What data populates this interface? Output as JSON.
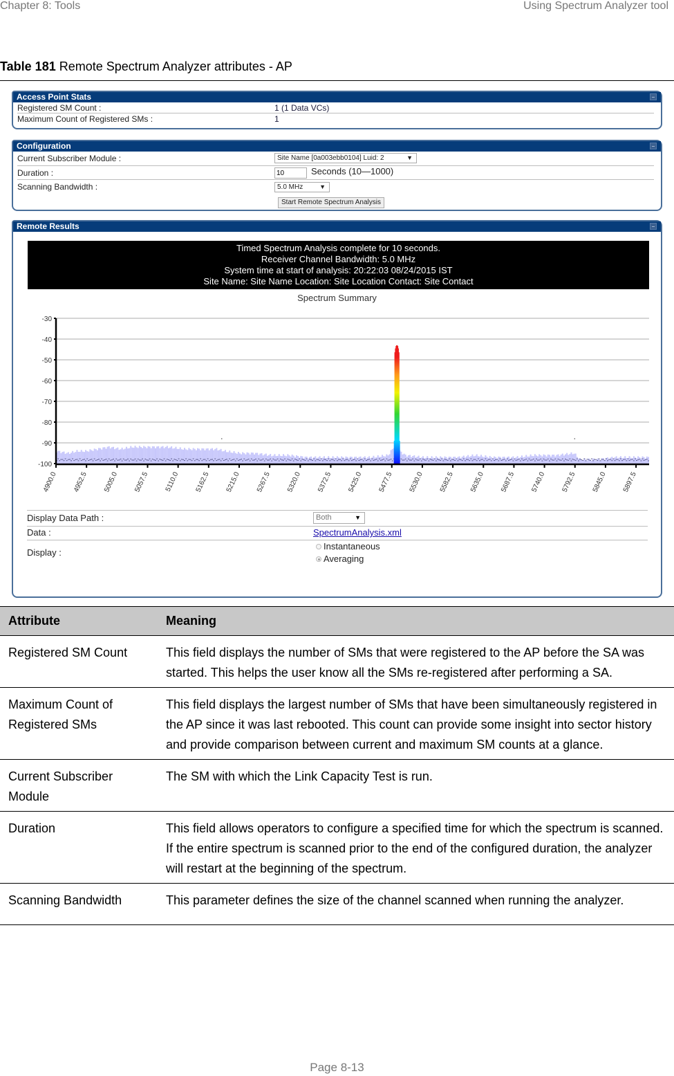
{
  "page_header": {
    "chapter": "Chapter 8:  Tools",
    "section": "Using Spectrum Analyzer tool"
  },
  "caption": {
    "label": "Table 181",
    "text": "Remote Spectrum Analyzer attributes - AP"
  },
  "ap_stats": {
    "title": "Access Point Stats",
    "rows": [
      {
        "label": "Registered SM Count :",
        "value": "1 (1 Data VCs)"
      },
      {
        "label": "Maximum Count of Registered SMs :",
        "value": "1"
      }
    ]
  },
  "configuration": {
    "title": "Configuration",
    "current_sm_label": "Current Subscriber Module :",
    "current_sm_value": "Site Name [0a003ebb0104] Luid: 2",
    "duration_label": "Duration :",
    "duration_value": "10",
    "duration_hint": "Seconds (10—1000)",
    "bandwidth_label": "Scanning Bandwidth :",
    "bandwidth_value": "5.0 MHz",
    "start_button": "Start Remote Spectrum Analysis"
  },
  "remote_results": {
    "title": "Remote Results",
    "banner": [
      "Timed Spectrum Analysis complete for 10 seconds.",
      "Receiver Channel Bandwidth: 5.0 MHz",
      "System time at start of analysis: 20:22:03 08/24/2015 IST",
      "Site Name: Site Name  Location: Site Location  Contact: Site Contact"
    ],
    "display_data_path_label": "Display Data Path :",
    "display_data_path_value": "Both",
    "data_label": "Data :",
    "data_link": "SpectrumAnalysis.xml",
    "display_label": "Display :",
    "display_options": [
      {
        "label": "Instantaneous",
        "selected": false
      },
      {
        "label": "Averaging",
        "selected": true
      }
    ]
  },
  "chart_data": {
    "type": "bar",
    "title": "Spectrum Summary",
    "xlabel": "",
    "ylabel": "",
    "ylim": [
      -100,
      -30
    ],
    "xlim": [
      4900.0,
      5920.0
    ],
    "grid": true,
    "yticks": [
      "-30",
      "-40",
      "-50",
      "-60",
      "-70",
      "-80",
      "-90",
      "-100"
    ],
    "xticks": [
      "4900.0",
      "4952.5",
      "5005.0",
      "5057.5",
      "5110.0",
      "5162.5",
      "5215.0",
      "5267.5",
      "5320.0",
      "5372.5",
      "5425.0",
      "5477.5",
      "5530.0",
      "5582.5",
      "5635.0",
      "5687.5",
      "5740.0",
      "5792.5",
      "5845.0",
      "5897.5"
    ],
    "noise_floor_profile": [
      {
        "x": 4900,
        "y": -94
      },
      {
        "x": 4920,
        "y": -95
      },
      {
        "x": 4935,
        "y": -94
      },
      {
        "x": 4950,
        "y": -94
      },
      {
        "x": 4970,
        "y": -93
      },
      {
        "x": 4990,
        "y": -92
      },
      {
        "x": 5010,
        "y": -93
      },
      {
        "x": 5030,
        "y": -92
      },
      {
        "x": 5060,
        "y": -92
      },
      {
        "x": 5090,
        "y": -92
      },
      {
        "x": 5120,
        "y": -93
      },
      {
        "x": 5150,
        "y": -93
      },
      {
        "x": 5175,
        "y": -93
      },
      {
        "x": 5190,
        "y": -94
      },
      {
        "x": 5215,
        "y": -95
      },
      {
        "x": 5240,
        "y": -95
      },
      {
        "x": 5270,
        "y": -96
      },
      {
        "x": 5300,
        "y": -96
      },
      {
        "x": 5330,
        "y": -97
      },
      {
        "x": 5360,
        "y": -97
      },
      {
        "x": 5400,
        "y": -97
      },
      {
        "x": 5440,
        "y": -97
      },
      {
        "x": 5470,
        "y": -96
      },
      {
        "x": 5480,
        "y": -92
      },
      {
        "x": 5500,
        "y": -96
      },
      {
        "x": 5530,
        "y": -97
      },
      {
        "x": 5560,
        "y": -97
      },
      {
        "x": 5590,
        "y": -97
      },
      {
        "x": 5620,
        "y": -96
      },
      {
        "x": 5650,
        "y": -97
      },
      {
        "x": 5690,
        "y": -97
      },
      {
        "x": 5720,
        "y": -96
      },
      {
        "x": 5760,
        "y": -96
      },
      {
        "x": 5790,
        "y": -95
      },
      {
        "x": 5800,
        "y": -98
      },
      {
        "x": 5830,
        "y": -98
      },
      {
        "x": 5860,
        "y": -97
      },
      {
        "x": 5890,
        "y": -97
      },
      {
        "x": 5920,
        "y": -97
      }
    ],
    "peak": {
      "center": 5485,
      "width_mhz": 8,
      "max": -43
    },
    "outliers": [
      {
        "x": 5185,
        "y": -88
      },
      {
        "x": 5792,
        "y": -88
      }
    ]
  },
  "attribute_table": {
    "headers": [
      "Attribute",
      "Meaning"
    ],
    "rows": [
      [
        "Registered SM Count",
        "This field displays the number of SMs that were registered to the AP before the SA was started. This helps the user know all the SMs re-registered after performing a SA."
      ],
      [
        "Maximum Count of Registered SMs",
        "This field displays the largest number of SMs that have been simultaneously registered in the AP since it was last rebooted. This count can provide some insight into sector history and provide comparison between current and maximum SM counts at a glance."
      ],
      [
        "Current Subscriber Module",
        "The SM with which the Link Capacity Test is run."
      ],
      [
        "Duration",
        "This field allows operators to configure a specified time for which the spectrum is scanned. If the entire spectrum is scanned prior to the end of the configured duration, the analyzer will restart at the beginning of the spectrum."
      ],
      [
        "Scanning Bandwidth",
        "This parameter defines the size of the channel scanned when running the analyzer."
      ]
    ]
  },
  "footer": {
    "page": "Page 8-13"
  }
}
